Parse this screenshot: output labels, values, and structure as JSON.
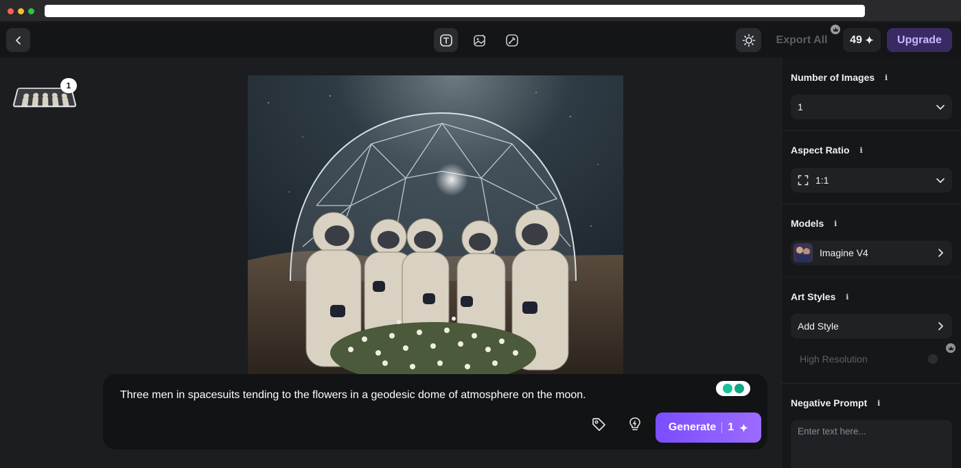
{
  "toolbar": {
    "export_label": "Export All",
    "credits": "49",
    "upgrade_label": "Upgrade"
  },
  "canvas": {
    "thumbnail_count": "1"
  },
  "prompt": {
    "text": "Three men in spacesuits tending to the flowers in a geodesic dome of atmosphere on the moon.",
    "generate_label": "Generate",
    "generate_cost": "1"
  },
  "panel": {
    "number_of_images": {
      "label": "Number of Images",
      "value": "1"
    },
    "aspect_ratio": {
      "label": "Aspect Ratio",
      "value": "1:1"
    },
    "models": {
      "label": "Models",
      "value": "Imagine V4"
    },
    "art_styles": {
      "label": "Art Styles",
      "value": "Add Style"
    },
    "high_resolution": {
      "label": "High Resolution"
    },
    "negative_prompt": {
      "label": "Negative Prompt",
      "placeholder": "Enter text here..."
    },
    "info_glyph": "i"
  },
  "colors": {
    "accent": "#7b4dff",
    "upgrade_bg": "#3a2a64",
    "upgrade_text": "#c9b6ff"
  },
  "icons": [
    "back-icon",
    "text-mode-icon",
    "image-edit-icon",
    "brush-icon",
    "sun-icon",
    "crown-icon",
    "sparkle-icon",
    "chevron-down-icon",
    "expand-icon",
    "chevron-right-icon",
    "tag-icon",
    "lightbulb-icon",
    "grammarly-icon"
  ]
}
